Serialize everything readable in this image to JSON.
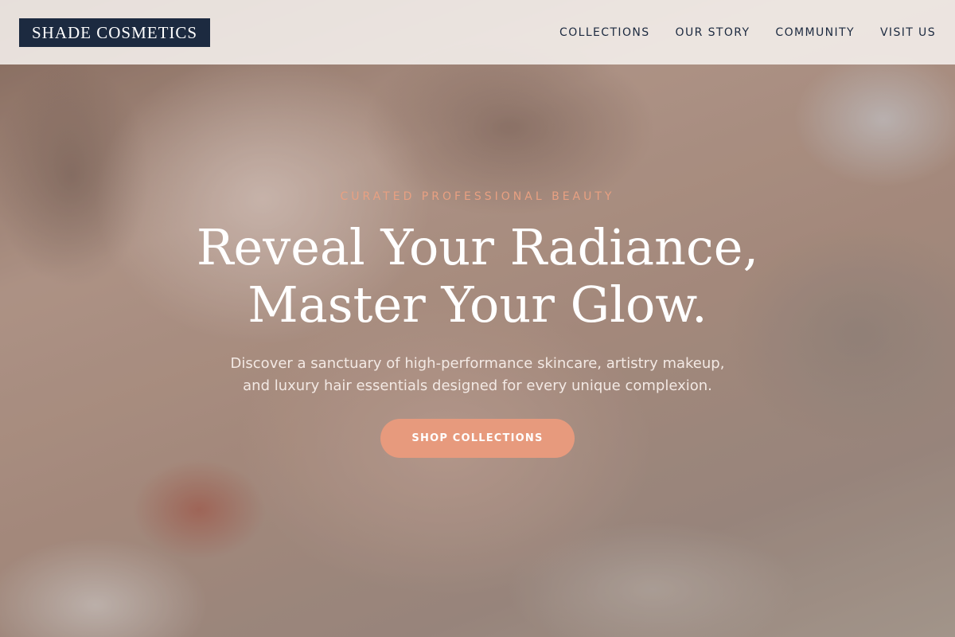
{
  "brand": {
    "logo_text": "SHADE COSMETICS"
  },
  "nav": {
    "items": [
      {
        "label": "COLLECTIONS"
      },
      {
        "label": "OUR STORY"
      },
      {
        "label": "COMMUNITY"
      },
      {
        "label": "VISIT US"
      }
    ]
  },
  "hero": {
    "eyebrow": "CURATED PROFESSIONAL BEAUTY",
    "headline_line1": "Reveal Your Radiance,",
    "headline_line2": "Master Your Glow.",
    "subtext_line1": "Discover a sanctuary of high-performance skincare, artistry makeup,",
    "subtext_line2": "and luxury hair essentials designed for every unique complexion.",
    "cta_label": "SHOP COLLECTIONS",
    "background_icon": "hero-photo-closeup-face"
  },
  "colors": {
    "logo_bg": "#1c2a40",
    "accent": "#e79a7d",
    "eyebrow": "#e8a082",
    "nav_text": "#1c2a40"
  }
}
